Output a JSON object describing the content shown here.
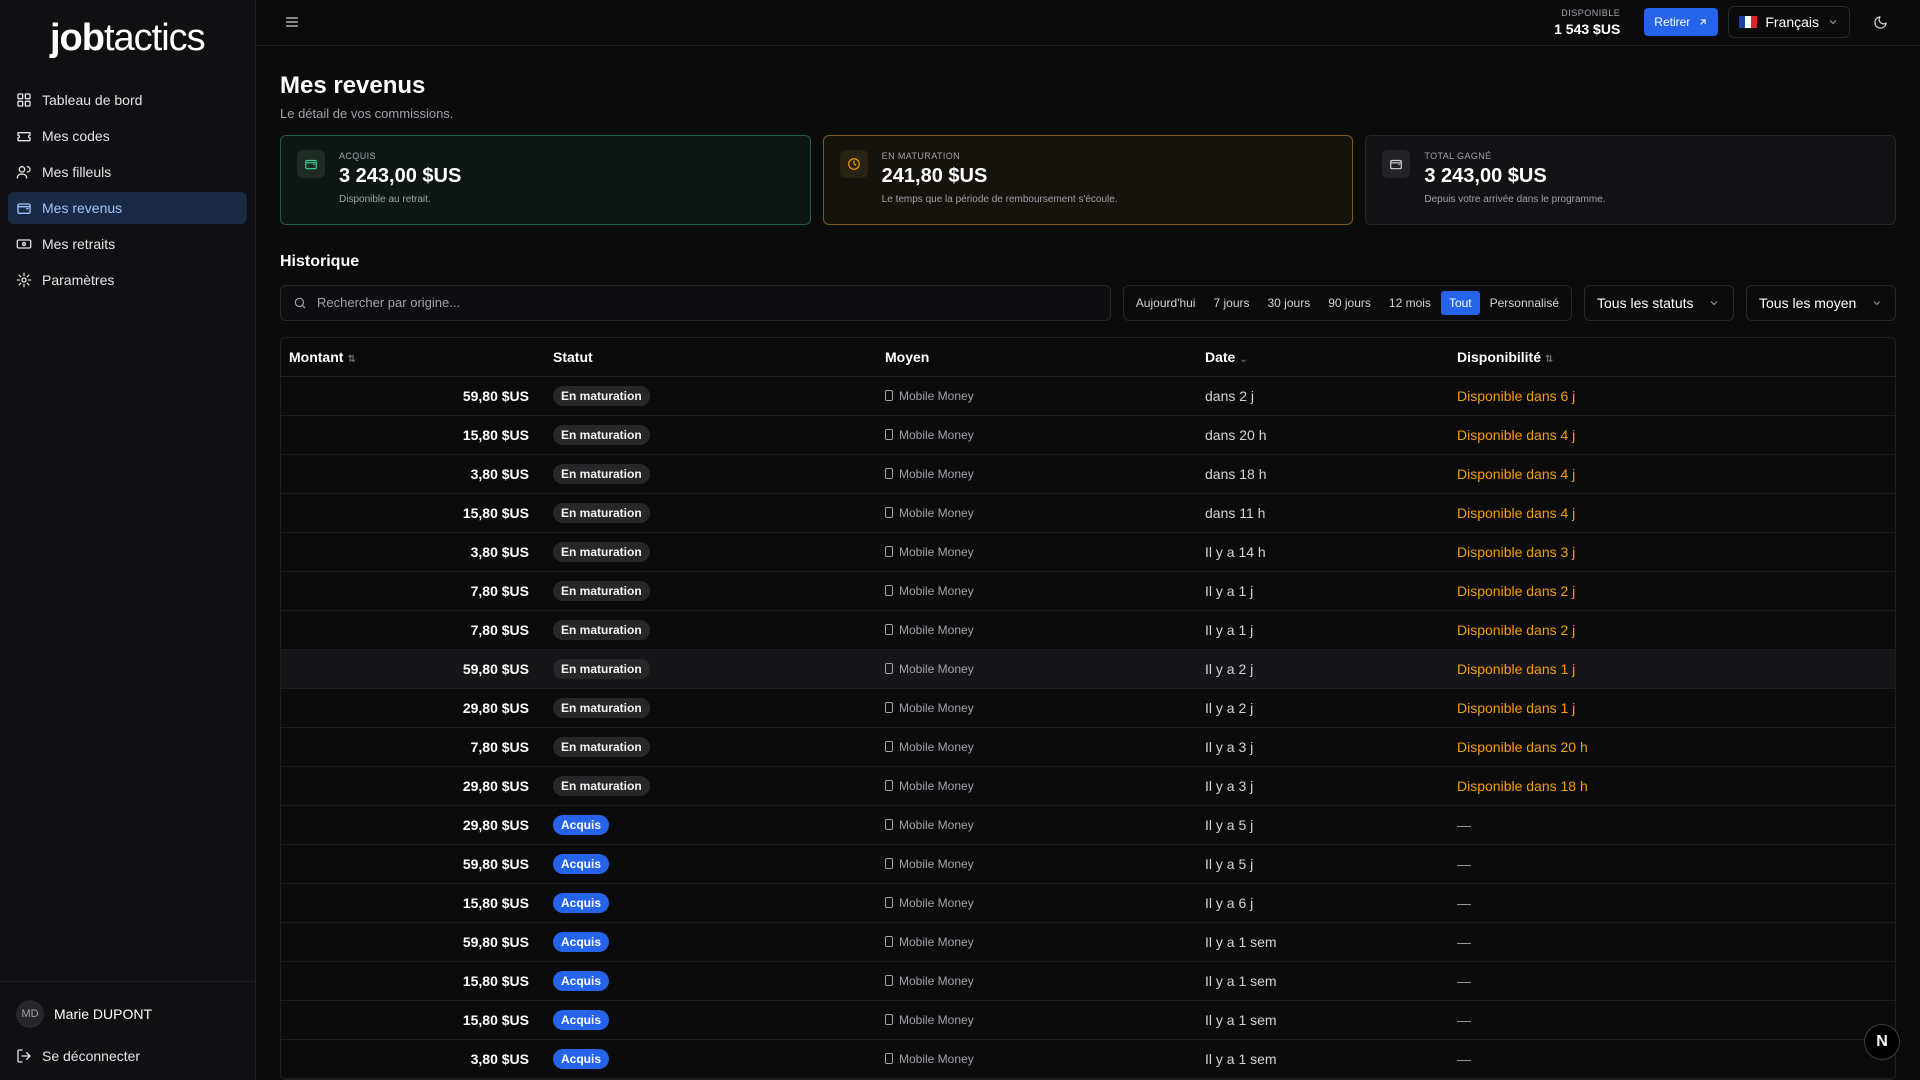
{
  "brand": {
    "bold": "job",
    "light": "tactics"
  },
  "sidebar": {
    "items": [
      {
        "label": "Tableau de bord",
        "icon": "dashboard-icon"
      },
      {
        "label": "Mes codes",
        "icon": "ticket-icon"
      },
      {
        "label": "Mes filleuls",
        "icon": "users-icon"
      },
      {
        "label": "Mes revenus",
        "icon": "wallet-icon",
        "active": true
      },
      {
        "label": "Mes retraits",
        "icon": "banknote-icon"
      },
      {
        "label": "Paramètres",
        "icon": "gear-icon"
      }
    ],
    "user": {
      "initials": "MD",
      "name": "Marie DUPONT"
    },
    "logout_label": "Se déconnecter"
  },
  "topbar": {
    "available_label": "DISPONIBLE",
    "available_value": "1 543 $US",
    "withdraw_label": "Retirer",
    "language": "Français"
  },
  "page": {
    "title": "Mes revenus",
    "subtitle": "Le détail de vos commissions."
  },
  "cards": [
    {
      "label": "ACQUIS",
      "value": "3 243,00 $US",
      "sub": "Disponible au retrait."
    },
    {
      "label": "EN MATURATION",
      "value": "241,80 $US",
      "sub": "Le temps que la période de remboursement s'écoule."
    },
    {
      "label": "TOTAL GAGNÉ",
      "value": "3 243,00 $US",
      "sub": "Depuis votre arrivée dans le programme."
    }
  ],
  "history": {
    "title": "Historique",
    "search_placeholder": "Rechercher par origine...",
    "ranges": [
      "Aujourd'hui",
      "7 jours",
      "30 jours",
      "90 jours",
      "12 mois",
      "Tout",
      "Personnalisé"
    ],
    "active_range": "Tout",
    "status_filter": "Tous les statuts",
    "method_filter": "Tous les moyens",
    "columns": {
      "amount": "Montant",
      "status": "Statut",
      "method": "Moyen",
      "date": "Date",
      "availability": "Disponibilité"
    },
    "rows": [
      {
        "amount": "59,80 $US",
        "status": "En maturation",
        "method": "Mobile Money",
        "date": "dans 2 j",
        "availability": "Disponible dans 6 j"
      },
      {
        "amount": "15,80 $US",
        "status": "En maturation",
        "method": "Mobile Money",
        "date": "dans 20 h",
        "availability": "Disponible dans 4 j"
      },
      {
        "amount": "3,80 $US",
        "status": "En maturation",
        "method": "Mobile Money",
        "date": "dans 18 h",
        "availability": "Disponible dans 4 j"
      },
      {
        "amount": "15,80 $US",
        "status": "En maturation",
        "method": "Mobile Money",
        "date": "dans 11 h",
        "availability": "Disponible dans 4 j"
      },
      {
        "amount": "3,80 $US",
        "status": "En maturation",
        "method": "Mobile Money",
        "date": "Il y a 14 h",
        "availability": "Disponible dans 3 j"
      },
      {
        "amount": "7,80 $US",
        "status": "En maturation",
        "method": "Mobile Money",
        "date": "Il y a 1 j",
        "availability": "Disponible dans 2 j"
      },
      {
        "amount": "7,80 $US",
        "status": "En maturation",
        "method": "Mobile Money",
        "date": "Il y a 1 j",
        "availability": "Disponible dans 2 j"
      },
      {
        "amount": "59,80 $US",
        "status": "En maturation",
        "method": "Mobile Money",
        "date": "Il y a 2 j",
        "availability": "Disponible dans 1 j",
        "highlight": true
      },
      {
        "amount": "29,80 $US",
        "status": "En maturation",
        "method": "Mobile Money",
        "date": "Il y a 2 j",
        "availability": "Disponible dans 1 j"
      },
      {
        "amount": "7,80 $US",
        "status": "En maturation",
        "method": "Mobile Money",
        "date": "Il y a 3 j",
        "availability": "Disponible dans 20 h"
      },
      {
        "amount": "29,80 $US",
        "status": "En maturation",
        "method": "Mobile Money",
        "date": "Il y a 3 j",
        "availability": "Disponible dans 18 h"
      },
      {
        "amount": "29,80 $US",
        "status": "Acquis",
        "method": "Mobile Money",
        "date": "Il y a 5 j",
        "availability": "—"
      },
      {
        "amount": "59,80 $US",
        "status": "Acquis",
        "method": "Mobile Money",
        "date": "Il y a 5 j",
        "availability": "—"
      },
      {
        "amount": "15,80 $US",
        "status": "Acquis",
        "method": "Mobile Money",
        "date": "Il y a 6 j",
        "availability": "—"
      },
      {
        "amount": "59,80 $US",
        "status": "Acquis",
        "method": "Mobile Money",
        "date": "Il y a 1 sem",
        "availability": "—"
      },
      {
        "amount": "15,80 $US",
        "status": "Acquis",
        "method": "Mobile Money",
        "date": "Il y a 1 sem",
        "availability": "—"
      },
      {
        "amount": "15,80 $US",
        "status": "Acquis",
        "method": "Mobile Money",
        "date": "Il y a 1 sem",
        "availability": "—"
      },
      {
        "amount": "3,80 $US",
        "status": "Acquis",
        "method": "Mobile Money",
        "date": "Il y a 1 sem",
        "availability": "—"
      }
    ]
  },
  "fab_label": "N",
  "colors": {
    "accent": "#2563eb",
    "amber": "#f59e0b",
    "green_border": "#1f5b46"
  }
}
